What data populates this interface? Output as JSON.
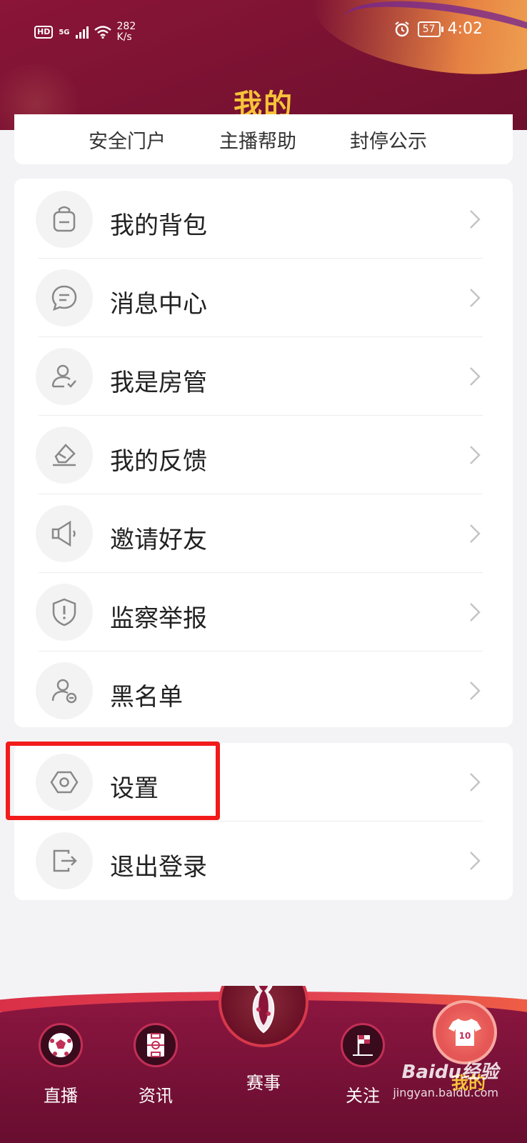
{
  "status_bar": {
    "hd": "HD",
    "signal": "5G",
    "net_speed_value": "282",
    "net_speed_unit": "K/s",
    "battery": "57",
    "time": "4:02"
  },
  "header": {
    "title": "我的"
  },
  "quick_links": [
    {
      "label": "安全门户"
    },
    {
      "label": "主播帮助"
    },
    {
      "label": "封停公示"
    }
  ],
  "menu_group1": [
    {
      "label": "我的背包",
      "icon": "backpack-icon"
    },
    {
      "label": "消息中心",
      "icon": "message-icon"
    },
    {
      "label": "我是房管",
      "icon": "room-manager-icon"
    },
    {
      "label": "我的反馈",
      "icon": "feedback-icon"
    },
    {
      "label": "邀请好友",
      "icon": "megaphone-icon"
    },
    {
      "label": "监察举报",
      "icon": "shield-alert-icon"
    },
    {
      "label": "黑名单",
      "icon": "blacklist-user-icon"
    }
  ],
  "menu_group2": [
    {
      "label": "设置",
      "icon": "settings-icon"
    },
    {
      "label": "退出登录",
      "icon": "logout-icon"
    }
  ],
  "bottom_nav": [
    {
      "label": "直播",
      "icon": "soccer-ball-icon"
    },
    {
      "label": "资讯",
      "icon": "pitch-icon"
    },
    {
      "label": "赛事",
      "icon": "world-cup-emblem-icon"
    },
    {
      "label": "关注",
      "icon": "corner-flag-icon"
    },
    {
      "label": "我的",
      "icon": "jersey-icon",
      "jersey_number": "10",
      "active": true
    }
  ],
  "watermark": {
    "brand": "Baidu经验",
    "url": "jingyan.baidu.com"
  },
  "colors": {
    "header_bg": "#8a1538",
    "title": "#f6c33a",
    "highlight": "#f21b1b"
  }
}
